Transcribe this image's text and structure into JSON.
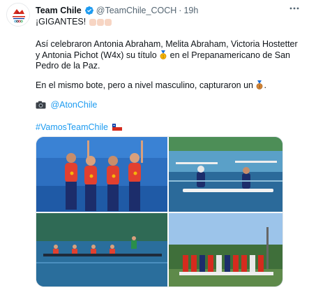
{
  "tweet": {
    "author_name": "Team Chile",
    "handle": "@TeamChile_COCH",
    "separator": "·",
    "time": "19h",
    "line1": "¡GIGANTES!",
    "para1_before": "Así celebraron Antonia Abraham, Melita Abraham, Victoria Hostetter y Antonia Pichot (W4x) su título",
    "para1_after": "en el Prepanamericano de San Pedro de la Paz.",
    "para2": "En el mismo bote, pero a nivel masculino, capturaron un",
    "para2_end": ".",
    "photo_credit": "@AtonChile",
    "hashtag": "#VamosTeamChile"
  },
  "icons": {
    "avatar": "team-chile-logo",
    "verified": "verified-badge-icon",
    "more": "more-options-icon",
    "camera": "camera-emoji",
    "gold_medal": "gold-medal-emoji",
    "bronze_medal": "bronze-medal-emoji",
    "flag": "chile-flag-emoji"
  },
  "colors": {
    "link": "#1d9bf0",
    "text": "#0f1419",
    "secondary": "#536471",
    "avatar_red": "#d52b1e"
  },
  "media": {
    "photos": [
      "rowers-celebrating-with-medals",
      "rowers-in-single-sculls",
      "rowing-eight-on-water",
      "team-podium-lineup"
    ]
  }
}
